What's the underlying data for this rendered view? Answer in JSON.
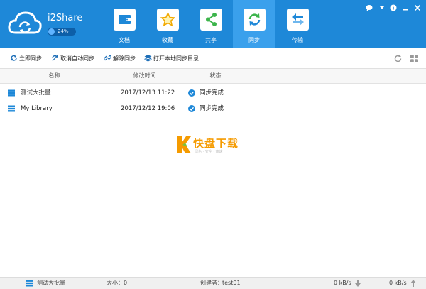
{
  "app": {
    "brand": "i2Share",
    "quota_percent_label": "24%"
  },
  "nav": [
    {
      "label": "文档",
      "icon": "wallet-icon"
    },
    {
      "label": "收藏",
      "icon": "star-icon"
    },
    {
      "label": "共享",
      "icon": "share-icon"
    },
    {
      "label": "同步",
      "icon": "sync-icon",
      "active": true
    },
    {
      "label": "传输",
      "icon": "transfer-icon"
    }
  ],
  "toolbar": {
    "sync_now": "立即同步",
    "cancel_auto_sync": "取消自动同步",
    "unsync": "解除同步",
    "open_local_dir": "打开本地同步目录"
  },
  "columns": {
    "name": "名称",
    "modified": "修改时间",
    "status": "状态"
  },
  "rows": [
    {
      "name": "测试大批量",
      "modified": "2017/12/13 11:22",
      "status": "同步完成"
    },
    {
      "name": "My Library",
      "modified": "2017/12/12 19:06",
      "status": "同步完成"
    }
  ],
  "watermark": {
    "logo_letter": "K",
    "main": "快盘下载",
    "sub": "绿色 · 安全 · 高速"
  },
  "statusbar": {
    "current_name": "测试大批量",
    "size_label": "大小：",
    "size_value": "0",
    "creator_label": "创建者：",
    "creator_value": "test01",
    "download_speed": "0 kB/s",
    "upload_speed": "0 kB/s"
  },
  "colors": {
    "header_bg": "#1e88d8",
    "active_tab_bg": "#3aa0ec",
    "check": "#1e88d8",
    "watermark": "#f59b00"
  }
}
